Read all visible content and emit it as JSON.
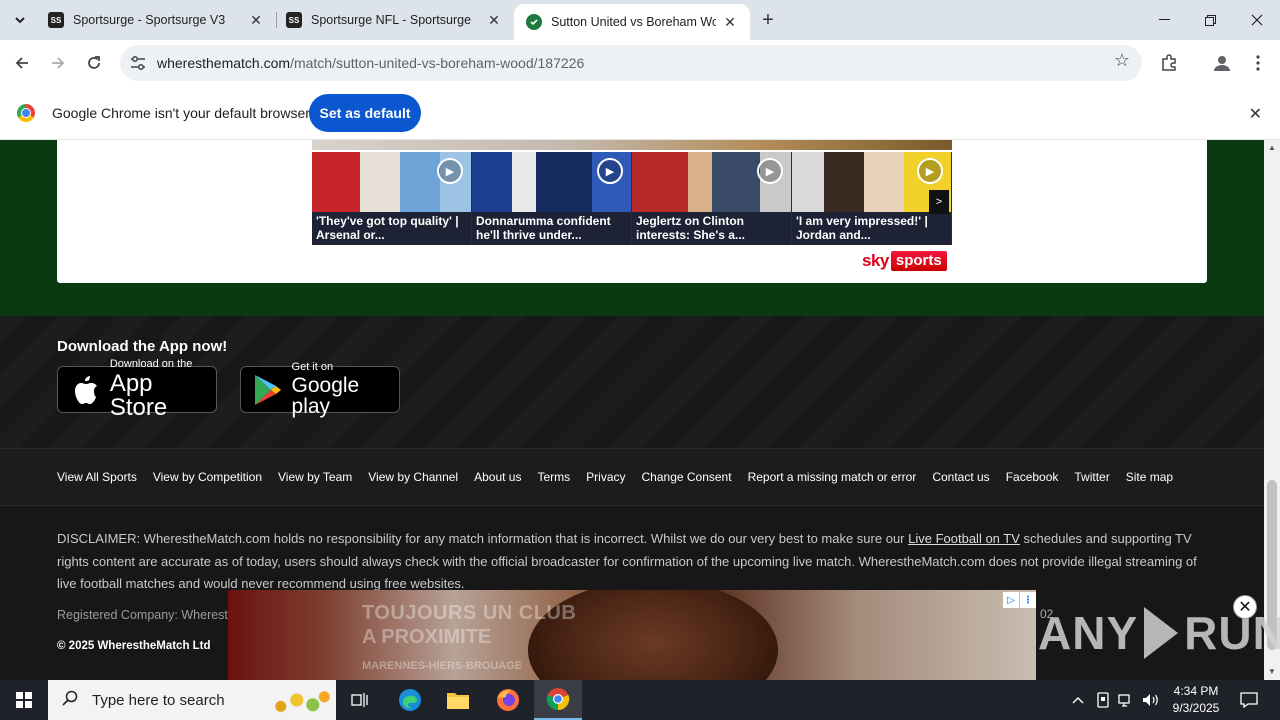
{
  "browser": {
    "tabs": [
      {
        "favicon": "SS",
        "title": "Sportsurge - Sportsurge V3",
        "active": false
      },
      {
        "favicon": "SS",
        "title": "Sportsurge NFL - Sportsurge",
        "active": false
      },
      {
        "favicon": "wtm-logo",
        "title": "Sutton United vs Boreham Woo",
        "active": true
      }
    ],
    "url_domain": "wheresthematch.com",
    "url_path": "/match/sutton-united-vs-boreham-wood/187226",
    "infobar": {
      "message": "Google Chrome isn't your default browser",
      "button": "Set as default"
    }
  },
  "videos": {
    "items": [
      {
        "caption": "'They've got top quality' | Arsenal or..."
      },
      {
        "caption": "Donnarumma confident he'll thrive under..."
      },
      {
        "caption": "Jeglertz on Clinton interests: She's a..."
      },
      {
        "caption": "'I am very impressed!' | Jordan and..."
      }
    ],
    "next_arrow": ">",
    "provider_sky": "sky",
    "provider_sports": "sports"
  },
  "app": {
    "title": "Download the App now!",
    "appstore_small": "Download on the",
    "appstore_big": "App Store",
    "play_small": "Get it on",
    "play_big": "Google play"
  },
  "footer": {
    "links": [
      "View All Sports",
      "View by Competition",
      "View by Team",
      "View by Channel",
      "About us",
      "Terms",
      "Privacy",
      "Change Consent",
      "Report a missing match or error",
      "Contact us",
      "Facebook",
      "Twitter",
      "Site map"
    ],
    "disclaimer_before": "DISCLAIMER: WherestheMatch.com holds no responsibility for any match information that is incorrect. Whilst we do our very best to make sure our ",
    "disclaimer_link": "Live Football on TV",
    "disclaimer_after": " schedules and supporting TV rights content are accurate as of today, users should always check with the official broadcaster for confirmation of the upcoming live match. WherestheMatch.com does not provide illegal streaming of live football matches and would never recommend using free websites.",
    "registered": "Registered Company: Wherest",
    "copyright": "© 2025 WherestheMatch Ltd"
  },
  "ad": {
    "line1": "TOUJOURS UN CLUB",
    "line2": "A PROXIMITE",
    "line3": "MARENNES-HIERS-BROUAGE"
  },
  "watermark": {
    "text_left": "ANY",
    "text_right": "RUN",
    "tag": "02"
  },
  "taskbar": {
    "search_placeholder": "Type here to search",
    "time": "4:34 PM",
    "date": "9/3/2025"
  }
}
